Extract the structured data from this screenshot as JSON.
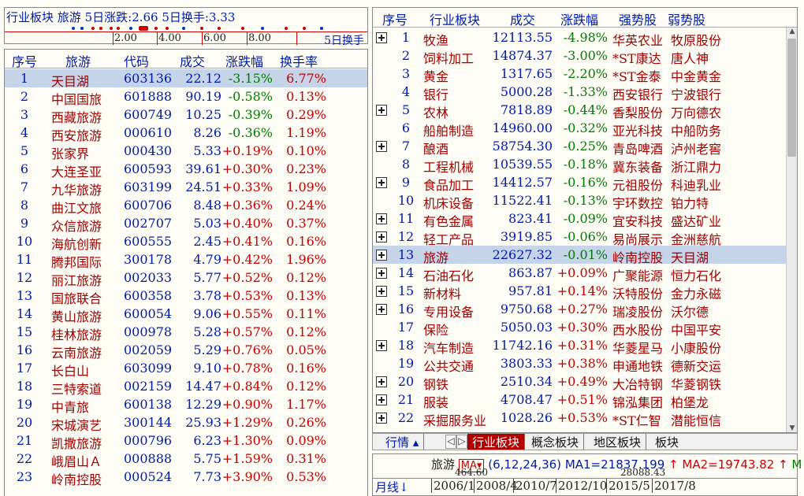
{
  "sector_header": {
    "label": "行业板块",
    "sector": "旅游",
    "five_day_change": "5日涨跌:2.66",
    "five_day_turnover": "5日换手:3.33",
    "scale_ticks": [
      "2.00",
      "4.00",
      "6.00",
      "8.00"
    ],
    "five_day_label": "5日换手"
  },
  "stock_table": {
    "headers": [
      "序号",
      "旅游",
      "代码",
      "成交",
      "涨跌幅",
      "换手率"
    ],
    "rows": [
      [
        "1",
        "天目湖",
        "603136",
        "22.12",
        "-3.15%",
        "6.77%"
      ],
      [
        "2",
        "中国国旅",
        "601888",
        "90.19",
        "-0.58%",
        "0.13%"
      ],
      [
        "3",
        "西藏旅游",
        "600749",
        "10.25",
        "-0.39%",
        "0.29%"
      ],
      [
        "4",
        "西安旅游",
        "000610",
        "8.26",
        "-0.36%",
        "1.19%"
      ],
      [
        "5",
        "张家界",
        "000430",
        "5.33",
        "+0.19%",
        "0.10%"
      ],
      [
        "6",
        "大连圣亚",
        "600593",
        "39.61",
        "+0.30%",
        "0.23%"
      ],
      [
        "7",
        "九华旅游",
        "603199",
        "24.51",
        "+0.33%",
        "1.09%"
      ],
      [
        "8",
        "曲江文旅",
        "600706",
        "8.48",
        "+0.36%",
        "0.24%"
      ],
      [
        "9",
        "众信旅游",
        "002707",
        "5.03",
        "+0.40%",
        "0.37%"
      ],
      [
        "10",
        "海航创新",
        "600555",
        "2.45",
        "+0.41%",
        "0.16%"
      ],
      [
        "11",
        "腾邦国际",
        "300178",
        "4.79",
        "+0.42%",
        "1.96%"
      ],
      [
        "12",
        "丽江旅游",
        "002033",
        "5.77",
        "+0.52%",
        "0.12%"
      ],
      [
        "13",
        "国旅联合",
        "600358",
        "3.78",
        "+0.53%",
        "0.13%"
      ],
      [
        "14",
        "黄山旅游",
        "600054",
        "9.06",
        "+0.55%",
        "0.11%"
      ],
      [
        "15",
        "桂林旅游",
        "000978",
        "5.28",
        "+0.57%",
        "0.12%"
      ],
      [
        "16",
        "云南旅游",
        "002059",
        "5.29",
        "+0.76%",
        "0.05%"
      ],
      [
        "17",
        "长白山",
        "603099",
        "9.10",
        "+0.78%",
        "0.16%"
      ],
      [
        "18",
        "三特索道",
        "002159",
        "14.47",
        "+0.84%",
        "0.12%"
      ],
      [
        "19",
        "中青旅",
        "600138",
        "12.29",
        "+0.90%",
        "1.17%"
      ],
      [
        "20",
        "宋城演艺",
        "300144",
        "25.93",
        "+1.29%",
        "0.26%"
      ],
      [
        "21",
        "凯撒旅游",
        "000796",
        "6.23",
        "+1.30%",
        "0.09%"
      ],
      [
        "22",
        "峨眉山Ａ",
        "000888",
        "5.75",
        "+1.59%",
        "0.31%"
      ],
      [
        "23",
        "岭南控股",
        "000524",
        "7.73",
        "+3.90%",
        "0.53%"
      ]
    ],
    "selected_index": 0
  },
  "sector_table": {
    "headers": [
      "序号",
      "行业板块",
      "成交",
      "涨跌幅",
      "强势股",
      "弱势股"
    ],
    "rows": [
      {
        "expand": true,
        "cells": [
          "1",
          "牧渔",
          "12113.55",
          "-4.98%",
          "华英农业",
          "牧原股份"
        ]
      },
      {
        "expand": false,
        "cells": [
          "2",
          "饲料加工",
          "14874.37",
          "-3.00%",
          "*ST康达",
          "唐人神"
        ]
      },
      {
        "expand": false,
        "cells": [
          "3",
          "黄金",
          "1317.65",
          "-2.20%",
          "*ST金泰",
          "中金黄金"
        ]
      },
      {
        "expand": false,
        "cells": [
          "4",
          "银行",
          "5000.28",
          "-1.33%",
          "西安银行",
          "宁波银行"
        ]
      },
      {
        "expand": true,
        "cells": [
          "5",
          "农林",
          "7818.89",
          "-0.44%",
          "香梨股份",
          "万向德农"
        ]
      },
      {
        "expand": false,
        "cells": [
          "6",
          "船舶制造",
          "14960.00",
          "-0.32%",
          "亚光科技",
          "中船防务"
        ]
      },
      {
        "expand": true,
        "cells": [
          "7",
          "酿酒",
          "58754.30",
          "-0.25%",
          "青岛啤酒",
          "泸州老窖"
        ]
      },
      {
        "expand": false,
        "cells": [
          "8",
          "工程机械",
          "10539.55",
          "-0.18%",
          "冀东装备",
          "浙江鼎力"
        ]
      },
      {
        "expand": true,
        "cells": [
          "9",
          "食品加工",
          "14412.57",
          "-0.16%",
          "元祖股份",
          "科迪乳业"
        ]
      },
      {
        "expand": false,
        "cells": [
          "10",
          "机床设备",
          "11522.41",
          "-0.13%",
          "宇环数控",
          "铂力特"
        ]
      },
      {
        "expand": true,
        "cells": [
          "11",
          "有色金属",
          "823.41",
          "-0.09%",
          "宜安科技",
          "盛达矿业"
        ]
      },
      {
        "expand": true,
        "cells": [
          "12",
          "轻工产品",
          "3919.85",
          "-0.06%",
          "易尚展示",
          "金洲慈航"
        ]
      },
      {
        "expand": true,
        "cells": [
          "13",
          "旅游",
          "22627.32",
          "-0.01%",
          "岭南控股",
          "天目湖"
        ]
      },
      {
        "expand": true,
        "cells": [
          "14",
          "石油石化",
          "863.87",
          "+0.09%",
          "广聚能源",
          "恒力石化"
        ]
      },
      {
        "expand": true,
        "cells": [
          "15",
          "新材料",
          "957.81",
          "+0.14%",
          "沃特股份",
          "金力永磁"
        ]
      },
      {
        "expand": true,
        "cells": [
          "16",
          "专用设备",
          "9750.68",
          "+0.27%",
          "瑞凌股份",
          "沃尔德"
        ]
      },
      {
        "expand": false,
        "cells": [
          "17",
          "保险",
          "5050.03",
          "+0.30%",
          "西水股份",
          "中国平安"
        ]
      },
      {
        "expand": true,
        "cells": [
          "18",
          "汽车制造",
          "11742.16",
          "+0.31%",
          "华菱星马",
          "小康股份"
        ]
      },
      {
        "expand": false,
        "cells": [
          "19",
          "公共交通",
          "3803.33",
          "+0.38%",
          "申通地铁",
          "德新交运"
        ]
      },
      {
        "expand": true,
        "cells": [
          "20",
          "钢铁",
          "2510.34",
          "+0.49%",
          "大冶特钢",
          "华菱钢铁"
        ]
      },
      {
        "expand": true,
        "cells": [
          "21",
          "服装",
          "4708.47",
          "+0.51%",
          "锦泓集团",
          "柏堡龙"
        ]
      },
      {
        "expand": true,
        "cells": [
          "22",
          "采掘服务业",
          "1028.26",
          "+0.53%",
          "*ST仁智",
          "潜能恒信"
        ]
      }
    ],
    "selected_index": 12
  },
  "tabs": {
    "hangqing": "行情",
    "items": [
      "行业板块",
      "概念板块",
      "地区板块",
      "板块"
    ]
  },
  "chart": {
    "name": "旅游",
    "ma_button": "MA",
    "params": "(6,12,24,36)",
    "ma1": "MA1=21837.199",
    "ma2": "MA2=19743.82",
    "extra": "M",
    "price_a": "464.60",
    "price_b": "28088.43",
    "period": "月线",
    "dates": [
      "2006/1",
      "2008/4",
      "2010/7",
      "2012/10",
      "2015/5",
      "2017/8"
    ]
  }
}
